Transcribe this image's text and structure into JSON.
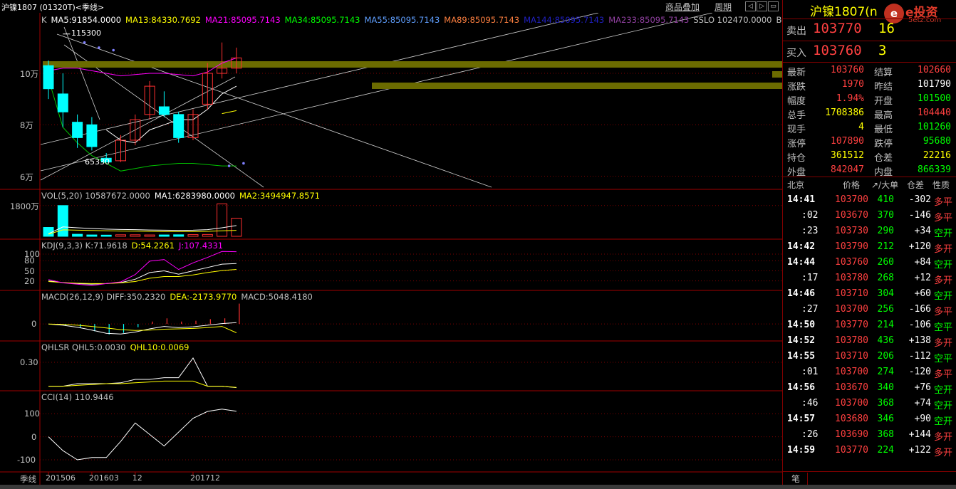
{
  "window": {
    "title": "沪镍1807 (01320T)<季线>",
    "btn_overlay": "商品叠加",
    "btn_period": "周期"
  },
  "main_legend": [
    {
      "text": "K",
      "color": "#c0c0c0"
    },
    {
      "text": "MA5:91854.0000",
      "color": "#ffffff"
    },
    {
      "text": "MA13:84330.7692",
      "color": "#ffff00"
    },
    {
      "text": "MA21:85095.7143",
      "color": "#ff00ff"
    },
    {
      "text": "MA34:85095.7143",
      "color": "#00ff00"
    },
    {
      "text": "MA55:85095.7143",
      "color": "#5f9fff"
    },
    {
      "text": "MA89:85095.7143",
      "color": "#ff8040"
    },
    {
      "text": "MA144:85095.7143",
      "color": "#2020c0"
    },
    {
      "text": "MA233:85095.7143",
      "color": "#9040a0"
    },
    {
      "text": "SSLO  102470.0000",
      "color": "#c0c0c0"
    },
    {
      "text": "BOLL(26,",
      "color": "#c0c0c0"
    }
  ],
  "main_axis": [
    "10万",
    "8万",
    "6万"
  ],
  "annotations": {
    "high": "115300",
    "low": "65330"
  },
  "vol_panel": {
    "legend": [
      {
        "text": "VOL(5,20)  10587672.0000",
        "color": "#c0c0c0"
      },
      {
        "text": "MA1:6283980.0000",
        "color": "#ffffff"
      },
      {
        "text": "MA2:3494947.8571",
        "color": "#ffff00"
      }
    ],
    "axis": [
      "1800万"
    ]
  },
  "kdj_panel": {
    "legend": [
      {
        "text": "KDJ(9,3,3)  K:71.9618",
        "color": "#c0c0c0"
      },
      {
        "text": "D:54.2261",
        "color": "#ffff00"
      },
      {
        "text": "J:107.4331",
        "color": "#ff00ff"
      }
    ],
    "axis": [
      "100",
      "80",
      "50",
      "20"
    ]
  },
  "macd_panel": {
    "legend": [
      {
        "text": "MACD(26,12,9)  DIFF:350.2320",
        "color": "#c0c0c0"
      },
      {
        "text": "DEA:-2173.9770",
        "color": "#ffff00"
      },
      {
        "text": "MACD:5048.4180",
        "color": "#c0c0c0"
      }
    ],
    "axis": [
      "0"
    ]
  },
  "qhlsr_panel": {
    "legend": [
      {
        "text": "QHLSR  QHL5:0.0030",
        "color": "#c0c0c0"
      },
      {
        "text": "QHL10:0.0069",
        "color": "#ffff00"
      }
    ],
    "axis": [
      "0.30"
    ]
  },
  "cci_panel": {
    "legend": [
      {
        "text": "CCI(14)  110.9446",
        "color": "#c0c0c0"
      }
    ],
    "axis": [
      "100",
      "0",
      "-100"
    ]
  },
  "x_axis": {
    "period_label": "季线",
    "ticks": [
      "201506",
      "201603",
      "12",
      "201712"
    ]
  },
  "quote": {
    "title": "沪镍1807",
    "title_suffix": "(n",
    "logo_glyph": "e",
    "logo_name": "e投资",
    "logo_url": "5etz.com",
    "sell_label": "卖出",
    "sell_price": "103770",
    "sell_qty": "16",
    "buy_label": "买入",
    "buy_price": "103760",
    "buy_qty": "3",
    "stats": [
      {
        "l1": "最新",
        "v1": "103760",
        "c1": "#ff4040",
        "l2": "结算",
        "v2": "102660",
        "c2": "#ff4040"
      },
      {
        "l1": "涨跌",
        "v1": "1970",
        "c1": "#ff4040",
        "l2": "昨结",
        "v2": "101790",
        "c2": "#ffffff"
      },
      {
        "l1": "幅度",
        "v1": "1.94%",
        "c1": "#ff4040",
        "l2": "开盘",
        "v2": "101500",
        "c2": "#00ff00"
      },
      {
        "l1": "总手",
        "v1": "1708386",
        "c1": "#ffff00",
        "l2": "最高",
        "v2": "104440",
        "c2": "#ff4040"
      },
      {
        "l1": "现手",
        "v1": "4",
        "c1": "#ffff00",
        "l2": "最低",
        "v2": "101260",
        "c2": "#00ff00"
      },
      {
        "l1": "涨停",
        "v1": "107890",
        "c1": "#ff4040",
        "l2": "跌停",
        "v2": "95680",
        "c2": "#00ff00"
      },
      {
        "l1": "持仓",
        "v1": "361512",
        "c1": "#ffff00",
        "l2": "仓差",
        "v2": "22216",
        "c2": "#ffff00"
      },
      {
        "l1": "外盘",
        "v1": "842047",
        "c1": "#ff4040",
        "l2": "内盘",
        "v2": "866339",
        "c2": "#00ff00"
      }
    ],
    "tick_header": {
      "c1": "北京",
      "c2": "价格",
      "c3": "↗/大单",
      "c4": "仓差",
      "c5": "性质"
    },
    "ticks": [
      {
        "time": "14:41",
        "price": "103700",
        "vol": "410",
        "diff": "-302",
        "nature": "多平",
        "nc": "#ff4040"
      },
      {
        "time": ":02",
        "price": "103670",
        "vol": "370",
        "diff": "-146",
        "nature": "多平",
        "nc": "#ff4040"
      },
      {
        "time": ":23",
        "price": "103730",
        "vol": "290",
        "diff": "+34",
        "nature": "空开",
        "nc": "#00ff00"
      },
      {
        "time": "14:42",
        "price": "103790",
        "vol": "212",
        "diff": "+120",
        "nature": "多开",
        "nc": "#ff4040"
      },
      {
        "time": "14:44",
        "price": "103760",
        "vol": "260",
        "diff": "+84",
        "nature": "空开",
        "nc": "#00ff00"
      },
      {
        "time": ":17",
        "price": "103780",
        "vol": "268",
        "diff": "+12",
        "nature": "多开",
        "nc": "#ff4040"
      },
      {
        "time": "14:46",
        "price": "103710",
        "vol": "304",
        "diff": "+60",
        "nature": "空开",
        "nc": "#00ff00"
      },
      {
        "time": ":27",
        "price": "103700",
        "vol": "256",
        "diff": "-166",
        "nature": "多平",
        "nc": "#ff4040"
      },
      {
        "time": "14:50",
        "price": "103770",
        "vol": "214",
        "diff": "-106",
        "nature": "空平",
        "nc": "#00ff00"
      },
      {
        "time": "14:52",
        "price": "103780",
        "vol": "436",
        "diff": "+138",
        "nature": "多开",
        "nc": "#ff4040"
      },
      {
        "time": "14:55",
        "price": "103710",
        "vol": "206",
        "diff": "-112",
        "nature": "空平",
        "nc": "#00ff00"
      },
      {
        "time": ":01",
        "price": "103700",
        "vol": "274",
        "diff": "-120",
        "nature": "多平",
        "nc": "#ff4040"
      },
      {
        "time": "14:56",
        "price": "103670",
        "vol": "340",
        "diff": "+76",
        "nature": "空开",
        "nc": "#00ff00"
      },
      {
        "time": ":46",
        "price": "103700",
        "vol": "368",
        "diff": "+74",
        "nature": "空开",
        "nc": "#00ff00"
      },
      {
        "time": "14:57",
        "price": "103680",
        "vol": "346",
        "diff": "+90",
        "nature": "空开",
        "nc": "#00ff00"
      },
      {
        "time": ":26",
        "price": "103690",
        "vol": "368",
        "diff": "+144",
        "nature": "多开",
        "nc": "#ff4040"
      },
      {
        "time": "14:59",
        "price": "103770",
        "vol": "224",
        "diff": "+122",
        "nature": "多开",
        "nc": "#ff4040"
      }
    ],
    "bottom_tab": "笔"
  },
  "chart_data": {
    "type": "candlestick",
    "main": {
      "candles": [
        {
          "o": 103000,
          "c": 94000,
          "h": 105000,
          "l": 90000
        },
        {
          "o": 92000,
          "c": 85000,
          "h": 100000,
          "l": 79000
        },
        {
          "o": 81000,
          "c": 75000,
          "h": 84000,
          "l": 71000
        },
        {
          "o": 80000,
          "c": 71500,
          "h": 83000,
          "l": 70000
        },
        {
          "o": 67000,
          "c": 65500,
          "h": 69000,
          "l": 65330
        },
        {
          "o": 66000,
          "c": 74000,
          "h": 76000,
          "l": 65500
        },
        {
          "o": 74000,
          "c": 82000,
          "h": 84000,
          "l": 72000
        },
        {
          "o": 84000,
          "c": 95000,
          "h": 97000,
          "l": 82000
        },
        {
          "o": 87000,
          "c": 84000,
          "h": 93000,
          "l": 83000
        },
        {
          "o": 84000,
          "c": 75000,
          "h": 85000,
          "l": 73000
        },
        {
          "o": 75000,
          "c": 84000,
          "h": 86000,
          "l": 74000
        },
        {
          "o": 88000,
          "c": 100000,
          "h": 104000,
          "l": 86000
        },
        {
          "o": 100000,
          "c": 102000,
          "h": 112000,
          "l": 98000
        },
        {
          "o": 102000,
          "c": 106000,
          "h": 110000,
          "l": 100000
        }
      ],
      "ma5": [
        null,
        null,
        null,
        null,
        78000,
        74000,
        73000,
        78000,
        80000,
        82000,
        82000,
        86000,
        92000,
        95000
      ],
      "ma13": [
        null,
        null,
        null,
        null,
        null,
        null,
        null,
        null,
        null,
        null,
        null,
        null,
        84330,
        85500
      ],
      "ma21": [
        101000,
        102000,
        102000,
        101000,
        100000,
        99000,
        99500,
        100000,
        100000,
        99500,
        99000,
        100500,
        104000,
        106000
      ],
      "ma34": [
        98000,
        79000,
        73000,
        68000,
        65000,
        62000,
        63000,
        64000,
        64500,
        65000,
        65000,
        64500,
        64000,
        64000
      ],
      "sar": [
        null,
        null,
        112000,
        110000,
        109000,
        null,
        null,
        null,
        null,
        null,
        null,
        null,
        null,
        null
      ],
      "sar_low": [
        null,
        null,
        null,
        null,
        null,
        null,
        null,
        null,
        null,
        null,
        null,
        null,
        64000,
        65000
      ],
      "high": 115300,
      "low": 65330,
      "ylim": [
        56000,
        118000
      ]
    },
    "vol": {
      "values": [
        5200000,
        18000000,
        1200000,
        800000,
        700000,
        900000,
        900000,
        800000,
        800000,
        900000,
        1000000,
        1100000,
        19000000,
        10587672
      ],
      "up": [
        false,
        false,
        false,
        false,
        false,
        true,
        true,
        true,
        false,
        false,
        true,
        true,
        true,
        true
      ],
      "ma1": [
        1500000,
        5500000,
        5000000,
        4600000,
        4200000,
        4000000,
        3900000,
        3700000,
        3600000,
        3500000,
        3600000,
        3900000,
        5000000,
        6283980
      ],
      "ma2": [
        1200000,
        3800000,
        3600000,
        3400000,
        3200000,
        3100000,
        3000000,
        2900000,
        2800000,
        2800000,
        2800000,
        2900000,
        3200000,
        3494947
      ],
      "ylim": [
        0,
        20000000
      ]
    },
    "kdj": {
      "k": [
        20,
        15,
        12,
        10,
        12,
        15,
        25,
        45,
        50,
        40,
        50,
        60,
        70,
        71.96
      ],
      "d": [
        18,
        15,
        13,
        12,
        12,
        14,
        18,
        28,
        33,
        33,
        38,
        45,
        51,
        54.23
      ],
      "j": [
        24,
        14,
        10,
        6,
        12,
        17,
        39,
        79,
        84,
        54,
        74,
        90,
        108,
        107.43
      ],
      "ylim": [
        0,
        115
      ]
    },
    "macd": {
      "diff": [
        0,
        -300,
        -800,
        -1500,
        -2300,
        -2500,
        -2000,
        -1200,
        -600,
        -900,
        -700,
        -300,
        100,
        350.23
      ],
      "dea": [
        0,
        -100,
        -300,
        -600,
        -1000,
        -1400,
        -1600,
        -1500,
        -1300,
        -1200,
        -1100,
        -900,
        -600,
        -2173.98
      ],
      "bar": [
        0,
        -400,
        -1000,
        -1800,
        -2600,
        -2200,
        -800,
        600,
        1400,
        600,
        800,
        1200,
        1400,
        5048.42
      ],
      "ylim": [
        -3500,
        5500
      ]
    },
    "qhlsr": {
      "qhl5": [
        0.02,
        0.02,
        0.05,
        0.05,
        0.05,
        0.06,
        0.1,
        0.1,
        0.12,
        0.12,
        0.35,
        0.02,
        0.02,
        0.003
      ],
      "qhl10": [
        0.02,
        0.02,
        0.03,
        0.04,
        0.05,
        0.05,
        0.06,
        0.07,
        0.08,
        0.08,
        0.08,
        0.02,
        0.02,
        0.0069
      ],
      "ylim": [
        0,
        0.4
      ]
    },
    "cci": {
      "values": [
        0,
        -60,
        -100,
        -90,
        -90,
        -20,
        60,
        10,
        -40,
        20,
        80,
        110,
        120,
        110.94
      ],
      "ylim": [
        -140,
        150
      ]
    },
    "x_ticks": [
      "201506",
      "201603",
      "12",
      "201712"
    ]
  }
}
